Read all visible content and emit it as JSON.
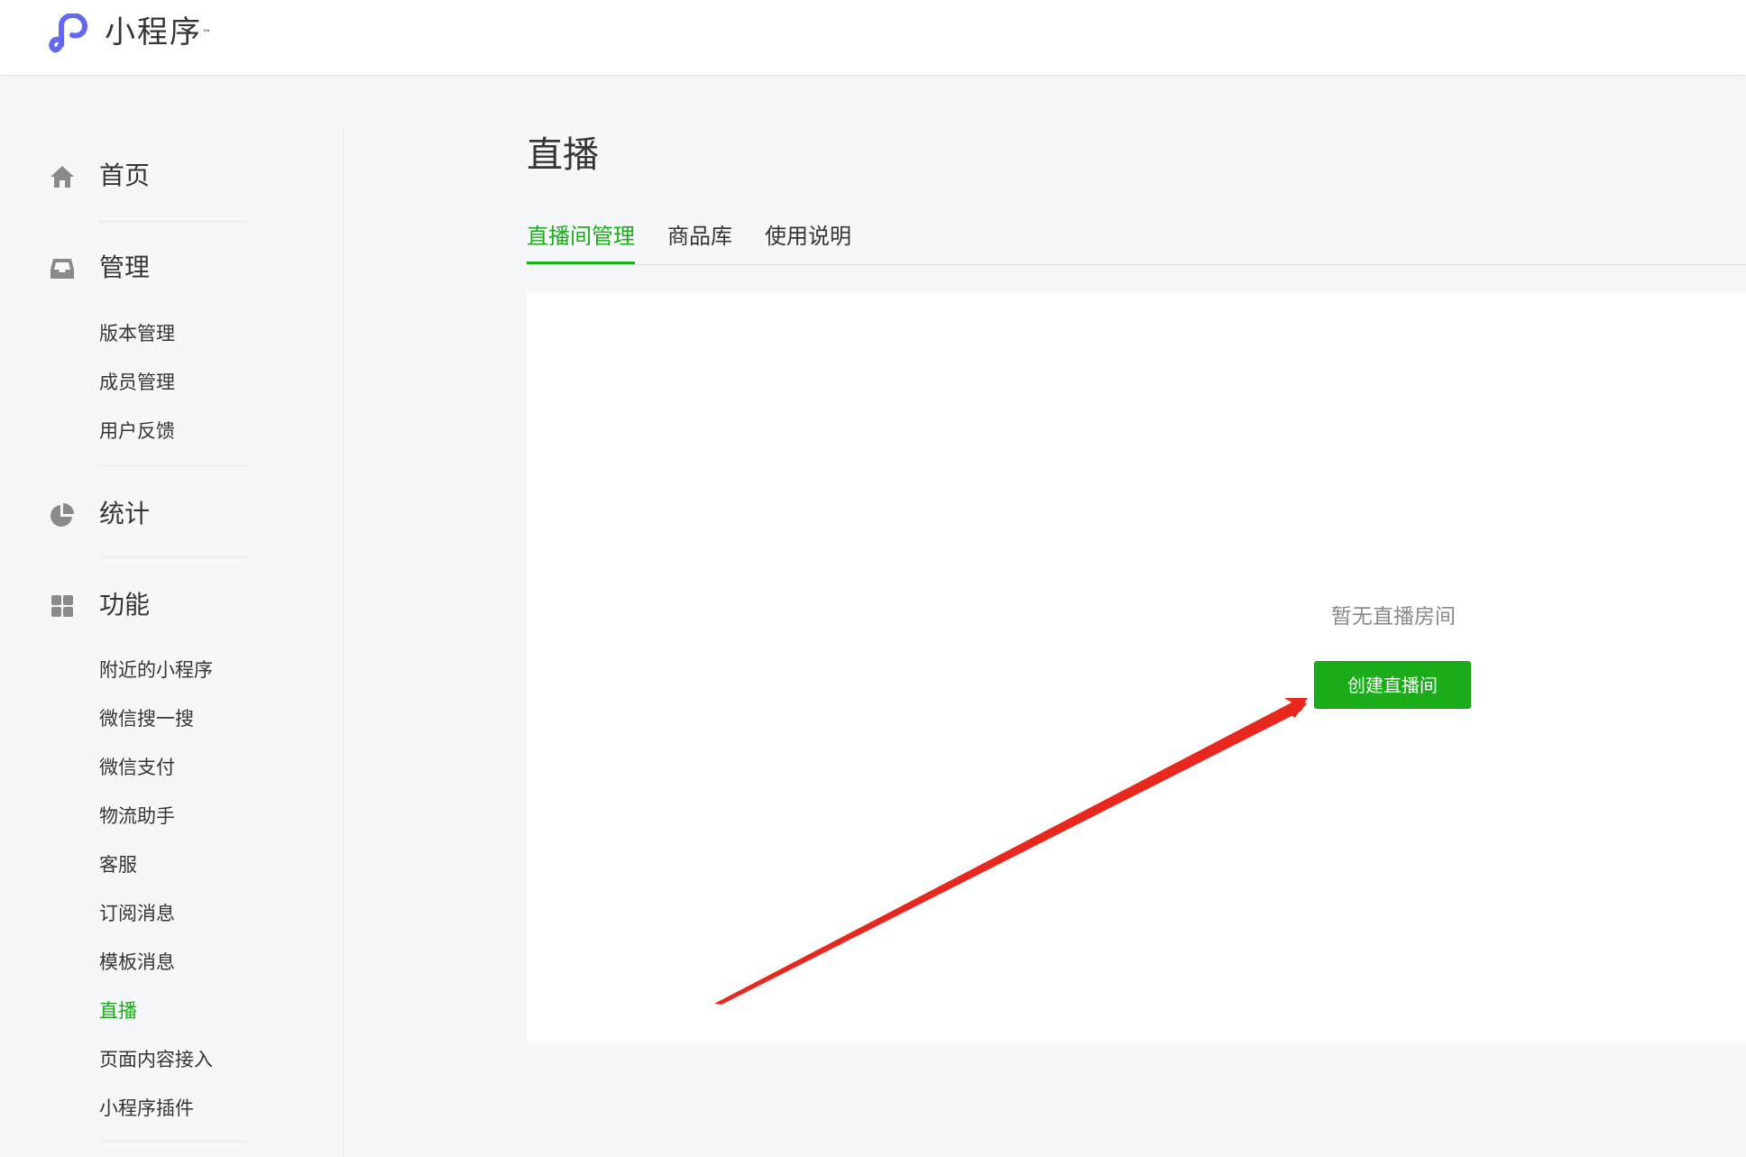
{
  "app": {
    "logo_name": "小程序",
    "logo_mark": "™",
    "logo_icon": "mini-program-logo-icon",
    "brand_color": "#6467f0",
    "accent_color": "#1aad19"
  },
  "sidebar": {
    "home": {
      "label": "首页",
      "icon": "home-icon"
    },
    "manage": {
      "label": "管理",
      "icon": "inbox-icon",
      "items": [
        "版本管理",
        "成员管理",
        "用户反馈"
      ]
    },
    "stats": {
      "label": "统计",
      "icon": "pie-chart-icon"
    },
    "features": {
      "label": "功能",
      "icon": "grid-icon",
      "items": [
        "附近的小程序",
        "微信搜一搜",
        "微信支付",
        "物流助手",
        "客服",
        "订阅消息",
        "模板消息",
        "直播",
        "页面内容接入",
        "小程序插件"
      ],
      "active_item": "直播"
    }
  },
  "main": {
    "title": "直播",
    "tabs": [
      "直播间管理",
      "商品库",
      "使用说明"
    ],
    "active_tab": "直播间管理",
    "empty_state": "暂无直播房间",
    "create_button": "创建直播间"
  },
  "annotation": {
    "arrow_color": "#e8271f"
  }
}
